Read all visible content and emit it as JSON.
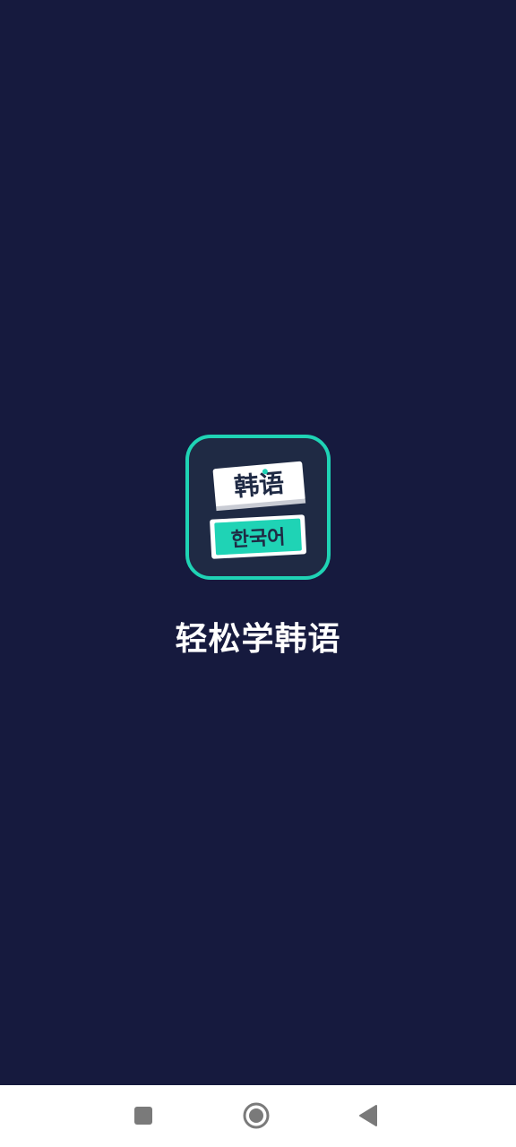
{
  "splash": {
    "app_name": "轻松学韩语",
    "icon": {
      "name": "app-logo-icon",
      "top_card_text": "韩语",
      "bottom_card_text": "한국어"
    }
  },
  "nav_bar": {
    "recents_icon": "square-icon",
    "home_icon": "circle-icon",
    "back_icon": "triangle-back-icon"
  },
  "colors": {
    "background": "#161a3e",
    "accent": "#1fd3b5",
    "icon_bg": "#1f2a44",
    "nav_bar": "#ffffff",
    "nav_icon": "#7a7a7a"
  }
}
